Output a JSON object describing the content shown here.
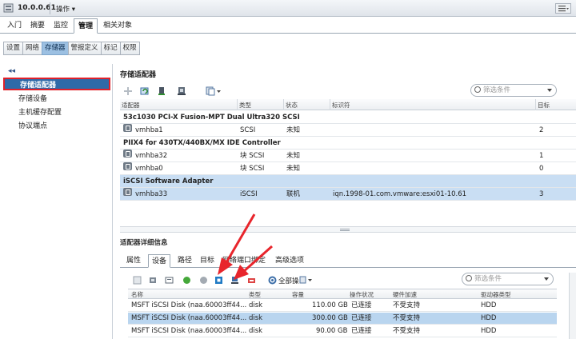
{
  "titlebar": {
    "host": "10.0.0.61",
    "ops_label": "操作 ▾"
  },
  "tabs": [
    {
      "label": "入门",
      "active": false
    },
    {
      "label": "摘要",
      "active": false
    },
    {
      "label": "监控",
      "active": false
    },
    {
      "label": "管理",
      "active": true
    },
    {
      "label": "相关对象",
      "active": false
    }
  ],
  "subtabs": [
    {
      "label": "设置",
      "active": false
    },
    {
      "label": "网络",
      "active": false
    },
    {
      "label": "存储器",
      "active": true
    },
    {
      "label": "警报定义",
      "active": false
    },
    {
      "label": "标记",
      "active": false
    },
    {
      "label": "权限",
      "active": false
    }
  ],
  "sidebar": {
    "collapse": "◂◂",
    "items": [
      {
        "label": "存储适配器",
        "selected": true
      },
      {
        "label": "存储设备",
        "selected": false
      },
      {
        "label": "主机缓存配置",
        "selected": false
      },
      {
        "label": "协议端点",
        "selected": false
      }
    ]
  },
  "adapters": {
    "title": "存储适配器",
    "search_placeholder": "筛选条件",
    "columns": [
      "适配器",
      "类型",
      "状态",
      "标识符",
      "目标"
    ],
    "groups": [
      {
        "name": "53c1030 PCI-X Fusion-MPT Dual Ultra320 SCSI",
        "rows": [
          {
            "adapter": "vmhba1",
            "type": "SCSI",
            "status": "未知",
            "id": "",
            "targets": "2"
          }
        ]
      },
      {
        "name": "PIIX4 for 430TX/440BX/MX IDE Controller",
        "rows": [
          {
            "adapter": "vmhba32",
            "type": "块 SCSI",
            "status": "未知",
            "id": "",
            "targets": "1"
          },
          {
            "adapter": "vmhba0",
            "type": "块 SCSI",
            "status": "未知",
            "id": "",
            "targets": "0"
          }
        ]
      },
      {
        "name": "iSCSI Software Adapter",
        "rows": [
          {
            "adapter": "vmhba33",
            "type": "iSCSI",
            "status": "联机",
            "id": "iqn.1998-01.com.vmware:esxi01-10.61",
            "targets": "3"
          }
        ]
      }
    ]
  },
  "details": {
    "title": "适配器详细信息",
    "tabs": [
      {
        "label": "属性",
        "active": false
      },
      {
        "label": "设备",
        "active": true
      },
      {
        "label": "路径",
        "active": false
      },
      {
        "label": "目标",
        "active": false
      },
      {
        "label": "网络端口绑定",
        "active": false
      },
      {
        "label": "高级选项",
        "active": false
      }
    ],
    "toolbar_all_label": "全部操",
    "search_placeholder": "筛选条件",
    "columns": [
      "名称",
      "类型",
      "容量",
      "操作状况",
      "硬件加速",
      "驱动器类型"
    ],
    "rows": [
      {
        "name": "MSFT iSCSI Disk (naa.60003ff44...",
        "type": "disk",
        "capacity": "110.00 GB",
        "op": "已连接",
        "hw": "不受支持",
        "drive": "HDD",
        "selected": false
      },
      {
        "name": "MSFT iSCSI Disk (naa.60003ff44...",
        "type": "disk",
        "capacity": "300.00 GB",
        "op": "已连接",
        "hw": "不受支持",
        "drive": "HDD",
        "selected": true
      },
      {
        "name": "MSFT iSCSI Disk (naa.60003ff44...",
        "type": "disk",
        "capacity": "90.00 GB",
        "op": "已连接",
        "hw": "不受支持",
        "drive": "HDD",
        "selected": false
      }
    ]
  },
  "colors": {
    "accent": "#2f6aa8",
    "selection": "#c9def3",
    "highlight_border": "#e0212a",
    "arrow": "#e8252c"
  }
}
